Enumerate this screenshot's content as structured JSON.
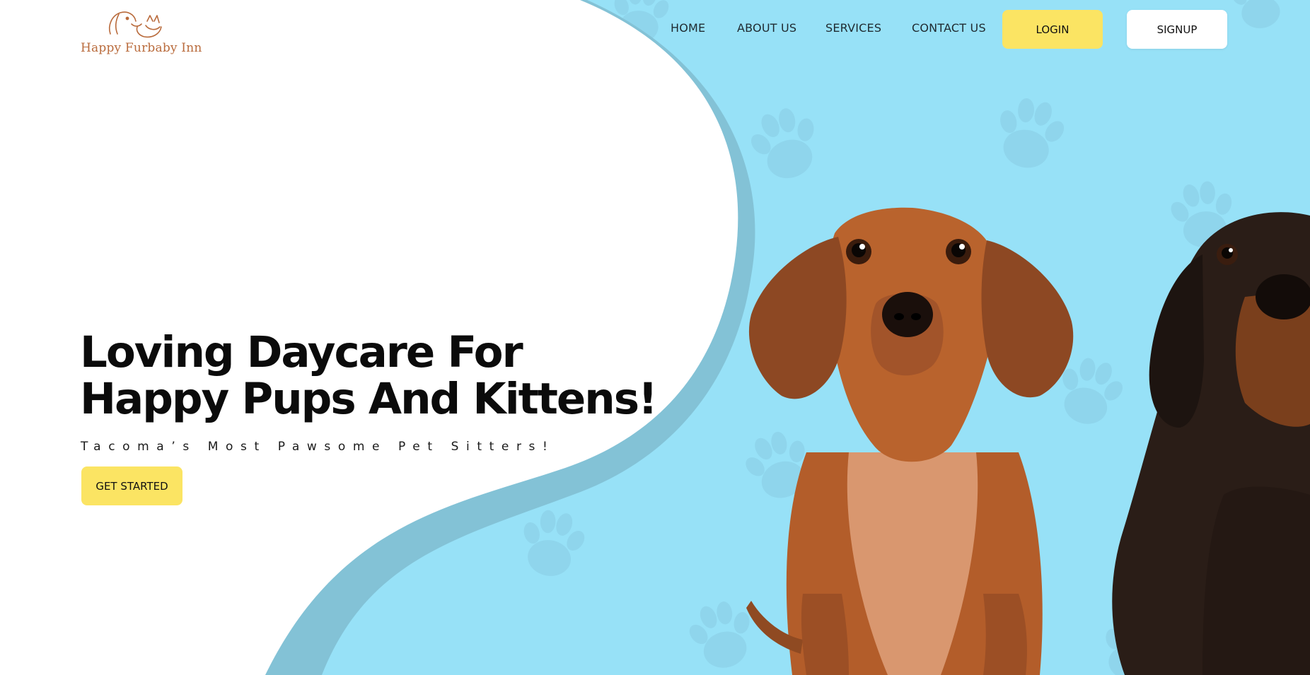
{
  "brand": {
    "name": "Happy Furbaby Inn"
  },
  "nav": {
    "links": [
      {
        "label": "HOME"
      },
      {
        "label": "ABOUT US"
      },
      {
        "label": "SERVICES"
      },
      {
        "label": "CONTACT US"
      }
    ],
    "login_label": "LOGIN",
    "signup_label": "SIGNUP"
  },
  "hero": {
    "headline_line1": "Loving Daycare For",
    "headline_line2": "Happy Pups And Kittens!",
    "tagline": "Tacoma’s Most Pawsome Pet Sitters!",
    "cta_label": "GET STARTED",
    "image": "two-dachshunds-photo",
    "pattern": "paw-print-icon"
  },
  "colors": {
    "accent_yellow": "#fbe463",
    "sky_blue": "#97e1f7",
    "wave_shadow": "#83c2d6",
    "logo_brown": "#b96b3c",
    "text_dark": "#0b0b0b"
  }
}
